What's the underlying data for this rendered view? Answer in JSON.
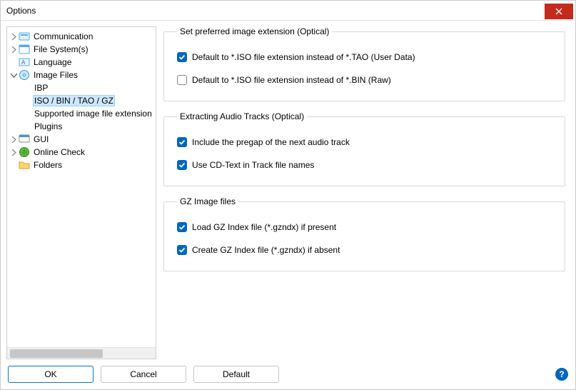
{
  "window": {
    "title": "Options"
  },
  "tree": {
    "communication": "Communication",
    "filesystems": "File System(s)",
    "language": "Language",
    "imagefiles": "Image Files",
    "ibp": "IBP",
    "isobin": "ISO / BIN / TAO / GZ",
    "supported": "Supported image file extension",
    "plugins": "Plugins",
    "gui": "GUI",
    "onlinecheck": "Online Check",
    "folders": "Folders"
  },
  "groups": {
    "preferred": {
      "legend": "Set preferred image extension (Optical)",
      "opt_tao": "Default to *.ISO file extension instead of *.TAO (User Data)",
      "opt_bin": "Default to *.ISO file extension instead of *.BIN (Raw)"
    },
    "extract": {
      "legend": "Extracting Audio Tracks (Optical)",
      "pregap": "Include the pregap of the next audio track",
      "cdtext": "Use CD-Text in Track file names"
    },
    "gz": {
      "legend": "GZ Image files",
      "load": "Load GZ Index file (*.gzndx) if present",
      "create": "Create GZ Index file (*.gzndx) if absent"
    }
  },
  "buttons": {
    "ok": "OK",
    "cancel": "Cancel",
    "default": "Default"
  }
}
